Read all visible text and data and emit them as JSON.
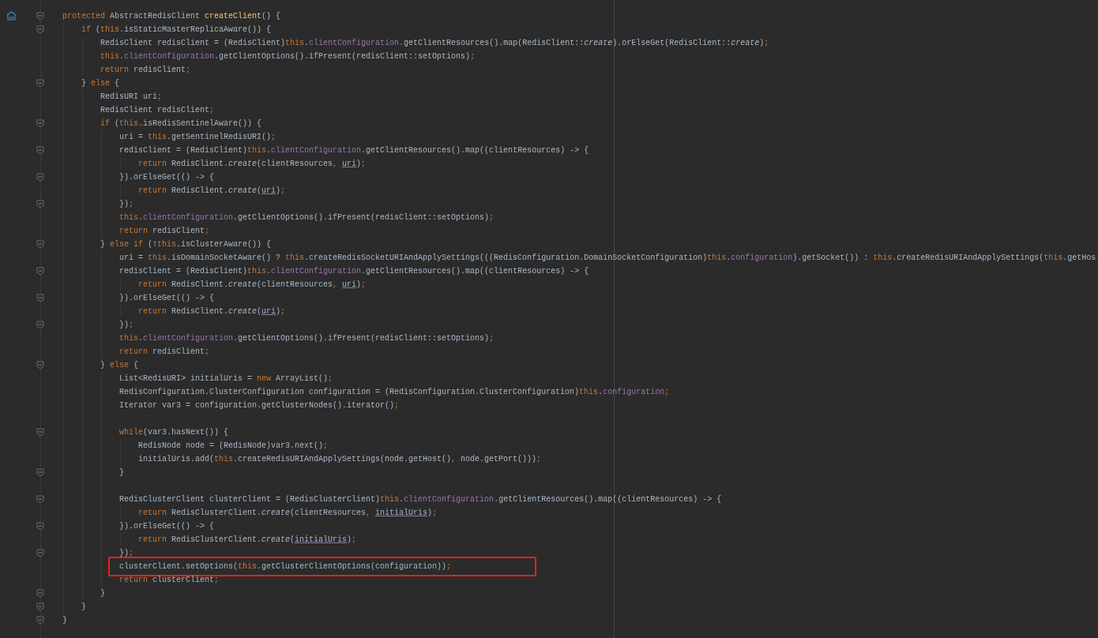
{
  "editor": {
    "lines": [
      {
        "kind": "code",
        "fold": true,
        "gutter_icon": true,
        "tokens": [
          {
            "kind": "keyword",
            "text": "protected "
          },
          {
            "kind": "plain",
            "text": "AbstractRedisClient "
          },
          {
            "kind": "method",
            "text": "createClient"
          },
          {
            "kind": "plain",
            "text": "() {"
          }
        ]
      },
      {
        "kind": "code",
        "fold": true,
        "tokens": [
          {
            "kind": "keyword",
            "text": "    if "
          },
          {
            "kind": "plain",
            "text": "("
          },
          {
            "kind": "keyword",
            "text": "this"
          },
          {
            "kind": "plain",
            "text": ".isStaticMasterReplicaAware()) {"
          }
        ]
      },
      {
        "kind": "code",
        "tokens": [
          {
            "kind": "plain",
            "text": "        RedisClient redisClient = (RedisClient)"
          },
          {
            "kind": "keyword",
            "text": "this"
          },
          {
            "kind": "plain",
            "text": "."
          },
          {
            "kind": "field",
            "text": "clientConfiguration"
          },
          {
            "kind": "plain",
            "text": ".getClientResources().map(RedisClient::"
          },
          {
            "kind": "static",
            "text": "create"
          },
          {
            "kind": "plain",
            "text": ").orElseGet(RedisClient::"
          },
          {
            "kind": "static",
            "text": "create"
          },
          {
            "kind": "plain",
            "text": ")"
          },
          {
            "kind": "keyword",
            "text": ";"
          }
        ]
      },
      {
        "kind": "code",
        "tokens": [
          {
            "kind": "keyword",
            "text": "        this"
          },
          {
            "kind": "plain",
            "text": "."
          },
          {
            "kind": "field",
            "text": "clientConfiguration"
          },
          {
            "kind": "plain",
            "text": ".getClientOptions().ifPresent(redisClient::setOptions)"
          },
          {
            "kind": "keyword",
            "text": ";"
          }
        ]
      },
      {
        "kind": "code",
        "tokens": [
          {
            "kind": "keyword",
            "text": "        return "
          },
          {
            "kind": "plain",
            "text": "redisClient"
          },
          {
            "kind": "keyword",
            "text": ";"
          }
        ]
      },
      {
        "kind": "code",
        "fold": true,
        "tokens": [
          {
            "kind": "plain",
            "text": "    } "
          },
          {
            "kind": "keyword",
            "text": "else "
          },
          {
            "kind": "plain",
            "text": "{"
          }
        ]
      },
      {
        "kind": "code",
        "tokens": [
          {
            "kind": "plain",
            "text": "        RedisURI uri"
          },
          {
            "kind": "keyword",
            "text": ";"
          }
        ]
      },
      {
        "kind": "code",
        "tokens": [
          {
            "kind": "plain",
            "text": "        RedisClient redisClient"
          },
          {
            "kind": "keyword",
            "text": ";"
          }
        ]
      },
      {
        "kind": "code",
        "fold": true,
        "tokens": [
          {
            "kind": "keyword",
            "text": "        if "
          },
          {
            "kind": "plain",
            "text": "("
          },
          {
            "kind": "keyword",
            "text": "this"
          },
          {
            "kind": "plain",
            "text": ".isRedisSentinelAware()) {"
          }
        ]
      },
      {
        "kind": "code",
        "tokens": [
          {
            "kind": "plain",
            "text": "            uri = "
          },
          {
            "kind": "keyword",
            "text": "this"
          },
          {
            "kind": "plain",
            "text": ".getSentinelRedisURI()"
          },
          {
            "kind": "keyword",
            "text": ";"
          }
        ]
      },
      {
        "kind": "code",
        "fold": true,
        "tokens": [
          {
            "kind": "plain",
            "text": "            redisClient = (RedisClient)"
          },
          {
            "kind": "keyword",
            "text": "this"
          },
          {
            "kind": "plain",
            "text": "."
          },
          {
            "kind": "field",
            "text": "clientConfiguration"
          },
          {
            "kind": "plain",
            "text": ".getClientResources().map((clientResources) -> {"
          }
        ]
      },
      {
        "kind": "code",
        "tokens": [
          {
            "kind": "keyword",
            "text": "                return "
          },
          {
            "kind": "plain",
            "text": "RedisClient."
          },
          {
            "kind": "static",
            "text": "create"
          },
          {
            "kind": "plain",
            "text": "(clientResources"
          },
          {
            "kind": "keyword",
            "text": ", "
          },
          {
            "kind": "param",
            "text": "uri"
          },
          {
            "kind": "plain",
            "text": ")"
          },
          {
            "kind": "keyword",
            "text": ";"
          }
        ]
      },
      {
        "kind": "code",
        "fold": true,
        "tokens": [
          {
            "kind": "plain",
            "text": "            }).orElseGet(() -> {"
          }
        ]
      },
      {
        "kind": "code",
        "tokens": [
          {
            "kind": "keyword",
            "text": "                return "
          },
          {
            "kind": "plain",
            "text": "RedisClient."
          },
          {
            "kind": "static",
            "text": "create"
          },
          {
            "kind": "plain",
            "text": "("
          },
          {
            "kind": "param",
            "text": "uri"
          },
          {
            "kind": "plain",
            "text": ")"
          },
          {
            "kind": "keyword",
            "text": ";"
          }
        ]
      },
      {
        "kind": "code",
        "fold": true,
        "tokens": [
          {
            "kind": "plain",
            "text": "            })"
          },
          {
            "kind": "keyword",
            "text": ";"
          }
        ]
      },
      {
        "kind": "code",
        "tokens": [
          {
            "kind": "keyword",
            "text": "            this"
          },
          {
            "kind": "plain",
            "text": "."
          },
          {
            "kind": "field",
            "text": "clientConfiguration"
          },
          {
            "kind": "plain",
            "text": ".getClientOptions().ifPresent(redisClient::setOptions)"
          },
          {
            "kind": "keyword",
            "text": ";"
          }
        ]
      },
      {
        "kind": "code",
        "tokens": [
          {
            "kind": "keyword",
            "text": "            return "
          },
          {
            "kind": "plain",
            "text": "redisClient"
          },
          {
            "kind": "keyword",
            "text": ";"
          }
        ]
      },
      {
        "kind": "code",
        "fold": true,
        "tokens": [
          {
            "kind": "plain",
            "text": "        } "
          },
          {
            "kind": "keyword",
            "text": "else if "
          },
          {
            "kind": "plain",
            "text": "(!"
          },
          {
            "kind": "keyword",
            "text": "this"
          },
          {
            "kind": "plain",
            "text": ".isClusterAware()) {"
          }
        ]
      },
      {
        "kind": "code",
        "tokens": [
          {
            "kind": "plain",
            "text": "            uri = "
          },
          {
            "kind": "keyword",
            "text": "this"
          },
          {
            "kind": "plain",
            "text": ".isDomainSocketAware() ? "
          },
          {
            "kind": "keyword",
            "text": "this"
          },
          {
            "kind": "plain",
            "text": ".createRedisSocketURIAndApplySettings(((RedisConfiguration.DomainSocketConfiguration)"
          },
          {
            "kind": "keyword",
            "text": "this"
          },
          {
            "kind": "plain",
            "text": "."
          },
          {
            "kind": "field",
            "text": "configuration"
          },
          {
            "kind": "plain",
            "text": ").getSocket()) : "
          },
          {
            "kind": "keyword",
            "text": "this"
          },
          {
            "kind": "plain",
            "text": ".createRedisURIAndApplySettings("
          },
          {
            "kind": "keyword",
            "text": "this"
          },
          {
            "kind": "plain",
            "text": ".getHos"
          }
        ]
      },
      {
        "kind": "code",
        "fold": true,
        "tokens": [
          {
            "kind": "plain",
            "text": "            redisClient = (RedisClient)"
          },
          {
            "kind": "keyword",
            "text": "this"
          },
          {
            "kind": "plain",
            "text": "."
          },
          {
            "kind": "field",
            "text": "clientConfiguration"
          },
          {
            "kind": "plain",
            "text": ".getClientResources().map((clientResources) -> {"
          }
        ]
      },
      {
        "kind": "code",
        "tokens": [
          {
            "kind": "keyword",
            "text": "                return "
          },
          {
            "kind": "plain",
            "text": "RedisClient."
          },
          {
            "kind": "static",
            "text": "create"
          },
          {
            "kind": "plain",
            "text": "(clientResources"
          },
          {
            "kind": "keyword",
            "text": ", "
          },
          {
            "kind": "param",
            "text": "uri"
          },
          {
            "kind": "plain",
            "text": ")"
          },
          {
            "kind": "keyword",
            "text": ";"
          }
        ]
      },
      {
        "kind": "code",
        "fold": true,
        "tokens": [
          {
            "kind": "plain",
            "text": "            }).orElseGet(() -> {"
          }
        ]
      },
      {
        "kind": "code",
        "tokens": [
          {
            "kind": "keyword",
            "text": "                return "
          },
          {
            "kind": "plain",
            "text": "RedisClient."
          },
          {
            "kind": "static",
            "text": "create"
          },
          {
            "kind": "plain",
            "text": "("
          },
          {
            "kind": "param",
            "text": "uri"
          },
          {
            "kind": "plain",
            "text": ")"
          },
          {
            "kind": "keyword",
            "text": ";"
          }
        ]
      },
      {
        "kind": "code",
        "fold": true,
        "tokens": [
          {
            "kind": "plain",
            "text": "            })"
          },
          {
            "kind": "keyword",
            "text": ";"
          }
        ]
      },
      {
        "kind": "code",
        "tokens": [
          {
            "kind": "keyword",
            "text": "            this"
          },
          {
            "kind": "plain",
            "text": "."
          },
          {
            "kind": "field",
            "text": "clientConfiguration"
          },
          {
            "kind": "plain",
            "text": ".getClientOptions().ifPresent(redisClient::setOptions)"
          },
          {
            "kind": "keyword",
            "text": ";"
          }
        ]
      },
      {
        "kind": "code",
        "tokens": [
          {
            "kind": "keyword",
            "text": "            return "
          },
          {
            "kind": "plain",
            "text": "redisClient"
          },
          {
            "kind": "keyword",
            "text": ";"
          }
        ]
      },
      {
        "kind": "code",
        "fold": true,
        "tokens": [
          {
            "kind": "plain",
            "text": "        } "
          },
          {
            "kind": "keyword",
            "text": "else "
          },
          {
            "kind": "plain",
            "text": "{"
          }
        ]
      },
      {
        "kind": "code",
        "tokens": [
          {
            "kind": "plain",
            "text": "            List<RedisURI> initialUris = "
          },
          {
            "kind": "keyword",
            "text": "new "
          },
          {
            "kind": "plain",
            "text": "ArrayList()"
          },
          {
            "kind": "keyword",
            "text": ";"
          }
        ]
      },
      {
        "kind": "code",
        "tokens": [
          {
            "kind": "plain",
            "text": "            RedisConfiguration.ClusterConfiguration configuration = (RedisConfiguration.ClusterConfiguration)"
          },
          {
            "kind": "keyword",
            "text": "this"
          },
          {
            "kind": "plain",
            "text": "."
          },
          {
            "kind": "field",
            "text": "configuration"
          },
          {
            "kind": "keyword",
            "text": ";"
          }
        ]
      },
      {
        "kind": "code",
        "tokens": [
          {
            "kind": "plain",
            "text": "            Iterator var3 = configuration.getClusterNodes().iterator()"
          },
          {
            "kind": "keyword",
            "text": ";"
          }
        ]
      },
      {
        "kind": "blank"
      },
      {
        "kind": "code",
        "fold": true,
        "tokens": [
          {
            "kind": "keyword",
            "text": "            while"
          },
          {
            "kind": "plain",
            "text": "(var3.hasNext()) {"
          }
        ]
      },
      {
        "kind": "code",
        "tokens": [
          {
            "kind": "plain",
            "text": "                RedisNode node = (RedisNode)var3.next()"
          },
          {
            "kind": "keyword",
            "text": ";"
          }
        ]
      },
      {
        "kind": "code",
        "tokens": [
          {
            "kind": "plain",
            "text": "                initialUris.add("
          },
          {
            "kind": "keyword",
            "text": "this"
          },
          {
            "kind": "plain",
            "text": ".createRedisURIAndApplySettings(node.getHost()"
          },
          {
            "kind": "keyword",
            "text": ", "
          },
          {
            "kind": "plain",
            "text": "node.getPort()))"
          },
          {
            "kind": "keyword",
            "text": ";"
          }
        ]
      },
      {
        "kind": "code",
        "fold": true,
        "tokens": [
          {
            "kind": "plain",
            "text": "            }"
          }
        ]
      },
      {
        "kind": "blank"
      },
      {
        "kind": "code",
        "fold": true,
        "tokens": [
          {
            "kind": "plain",
            "text": "            RedisClusterClient clusterClient = (RedisClusterClient)"
          },
          {
            "kind": "keyword",
            "text": "this"
          },
          {
            "kind": "plain",
            "text": "."
          },
          {
            "kind": "field",
            "text": "clientConfiguration"
          },
          {
            "kind": "plain",
            "text": ".getClientResources().map((clientResources) -> {"
          }
        ]
      },
      {
        "kind": "code",
        "tokens": [
          {
            "kind": "keyword",
            "text": "                return "
          },
          {
            "kind": "plain",
            "text": "RedisClusterClient."
          },
          {
            "kind": "static",
            "text": "create"
          },
          {
            "kind": "plain",
            "text": "(clientResources"
          },
          {
            "kind": "keyword",
            "text": ", "
          },
          {
            "kind": "param",
            "text": "initialUris"
          },
          {
            "kind": "plain",
            "text": ")"
          },
          {
            "kind": "keyword",
            "text": ";"
          }
        ]
      },
      {
        "kind": "code",
        "fold": true,
        "tokens": [
          {
            "kind": "plain",
            "text": "            }).orElseGet(() -> {"
          }
        ]
      },
      {
        "kind": "code",
        "tokens": [
          {
            "kind": "keyword",
            "text": "                return "
          },
          {
            "kind": "plain",
            "text": "RedisClusterClient."
          },
          {
            "kind": "static",
            "text": "create"
          },
          {
            "kind": "plain",
            "text": "("
          },
          {
            "kind": "param",
            "text": "initialUris"
          },
          {
            "kind": "plain",
            "text": ")"
          },
          {
            "kind": "keyword",
            "text": ";"
          }
        ]
      },
      {
        "kind": "code",
        "fold": true,
        "tokens": [
          {
            "kind": "plain",
            "text": "            })"
          },
          {
            "kind": "keyword",
            "text": ";"
          }
        ]
      },
      {
        "kind": "code",
        "highlighted": true,
        "tokens": [
          {
            "kind": "plain",
            "text": "            clusterClient.setOptions("
          },
          {
            "kind": "keyword",
            "text": "this"
          },
          {
            "kind": "plain",
            "text": ".getClusterClientOptions(configuration))"
          },
          {
            "kind": "keyword",
            "text": ";"
          }
        ]
      },
      {
        "kind": "code",
        "tokens": [
          {
            "kind": "keyword",
            "text": "            return "
          },
          {
            "kind": "plain",
            "text": "clusterClient"
          },
          {
            "kind": "keyword",
            "text": ";"
          }
        ]
      },
      {
        "kind": "code",
        "fold": true,
        "tokens": [
          {
            "kind": "plain",
            "text": "        }"
          }
        ]
      },
      {
        "kind": "code",
        "fold": true,
        "tokens": [
          {
            "kind": "plain",
            "text": "    }"
          }
        ]
      },
      {
        "kind": "code",
        "fold": true,
        "tokens": [
          {
            "kind": "plain",
            "text": "}"
          }
        ]
      }
    ]
  }
}
